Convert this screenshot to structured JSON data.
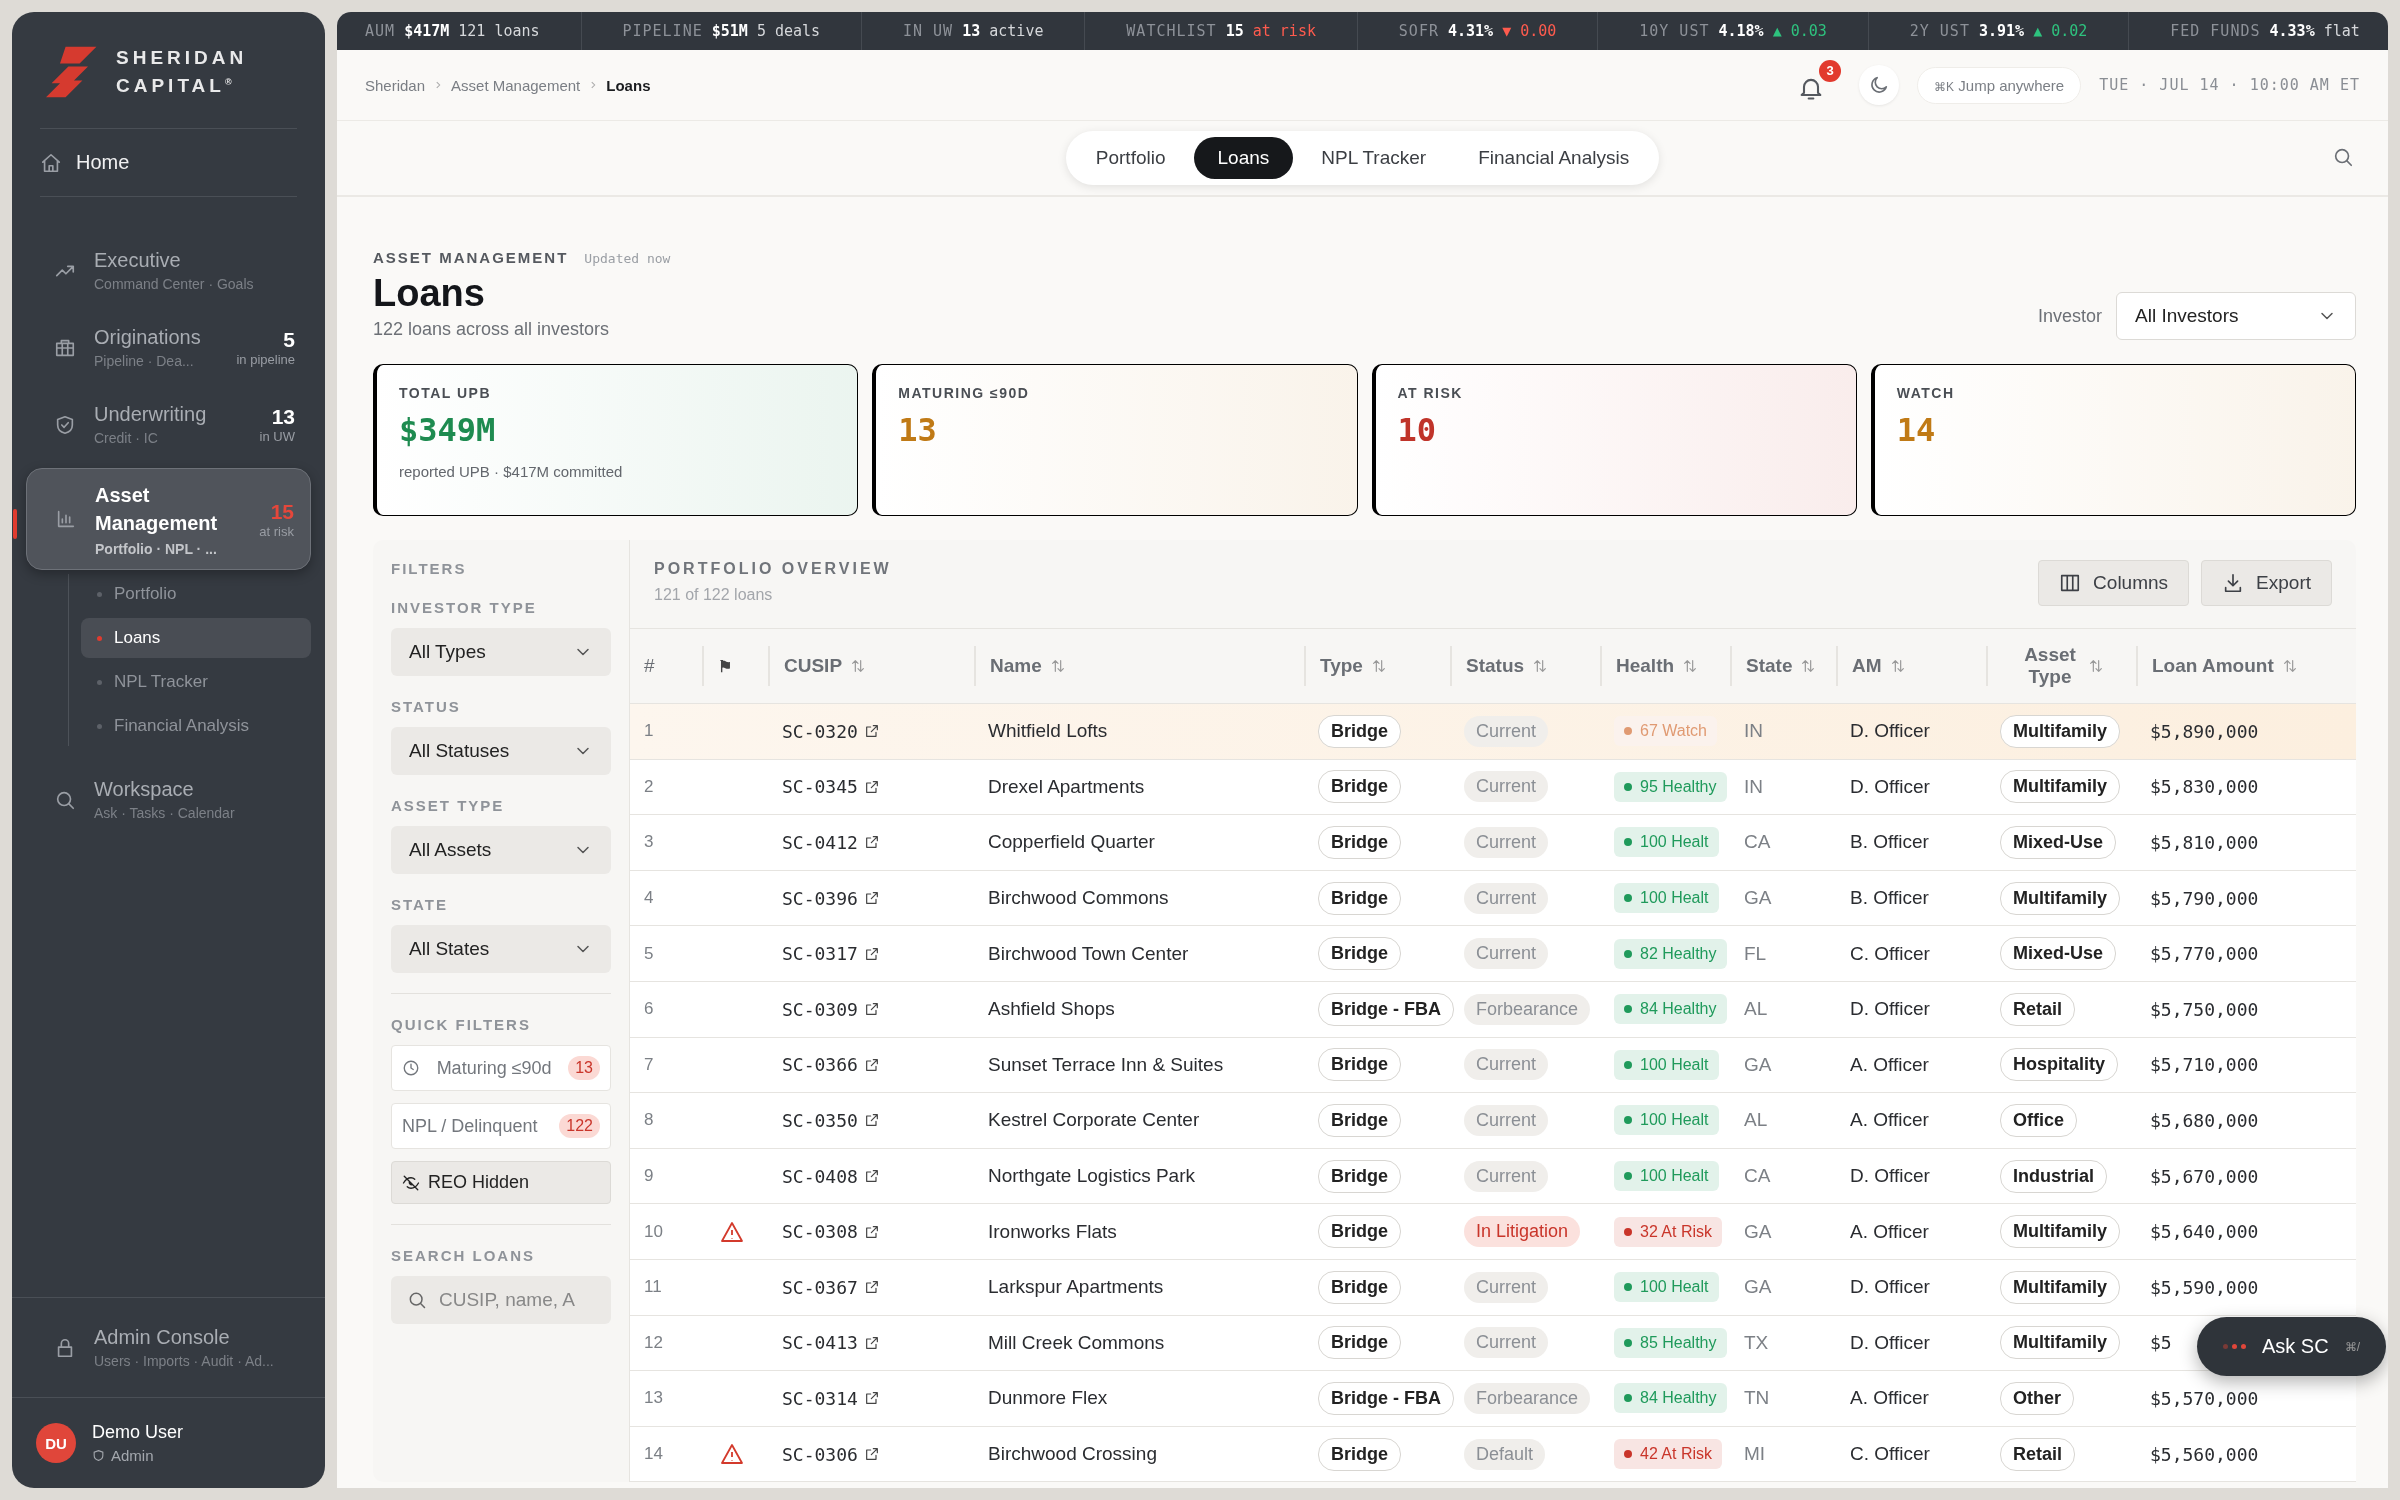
{
  "ticker": [
    {
      "label": "AUM",
      "value": "$417M",
      "note": "121 loans",
      "color": "#d6d8db"
    },
    {
      "label": "PIPELINE",
      "value": "$51M",
      "note": "5 deals",
      "color": "#d6d8db"
    },
    {
      "label": "IN UW",
      "value": "13",
      "note": "active",
      "color": "#d6d8db"
    },
    {
      "label": "WATCHLIST",
      "value": "15",
      "note": "at risk",
      "color": "#ff5b4e"
    },
    {
      "label": "SOFR",
      "value": "4.31%",
      "note": "▼ 0.00",
      "color": "#ff5b4e"
    },
    {
      "label": "10Y UST",
      "value": "4.18%",
      "note": "▲ 0.03",
      "color": "#2ec27e"
    },
    {
      "label": "2Y UST",
      "value": "3.91%",
      "note": "▲ 0.02",
      "color": "#2ec27e"
    },
    {
      "label": "FED FUNDS",
      "value": "4.33%",
      "note": "flat",
      "color": "#d6d8db"
    }
  ],
  "sidebar": {
    "logo": [
      "SHERIDAN",
      "CAPITAL"
    ],
    "logo_mark": "®",
    "home": {
      "label": "Home"
    },
    "items": [
      {
        "kind": "trend",
        "label": "Executive",
        "sub": "Command Center · Goals",
        "selected": false
      },
      {
        "kind": "briefcase",
        "label": "Originations",
        "sub": "Pipeline · Dea...",
        "count": "5",
        "count_note": "in pipeline",
        "color": "#ffffff",
        "selected": false
      },
      {
        "kind": "shield",
        "label": "Underwriting",
        "sub": "Credit · IC",
        "count": "13",
        "count_note": "in UW",
        "color": "#ffffff",
        "selected": false
      },
      {
        "kind": "chart",
        "label": "Asset Management",
        "sub": "Portfolio · NPL · ...",
        "count": "15",
        "count_note": "at risk",
        "color": "#e5473b",
        "selected": true,
        "children": [
          {
            "label": "Portfolio",
            "selected": false
          },
          {
            "label": "Loans",
            "selected": true
          },
          {
            "label": "NPL Tracker",
            "selected": false
          },
          {
            "label": "Financial Analysis",
            "selected": false
          }
        ]
      },
      {
        "kind": "search",
        "label": "Workspace",
        "sub": "Ask · Tasks · Calendar",
        "selected": false
      }
    ],
    "admin": {
      "label": "Admin Console",
      "sub": "Users · Imports · Audit · Ad..."
    },
    "user": {
      "initials": "DU",
      "name": "Demo User",
      "role": "Admin"
    }
  },
  "header": {
    "breadcrumbs": [
      "Sheridan",
      "Asset Management",
      "Loans"
    ],
    "notifications": "3",
    "jump": {
      "shortcut": "⌘K",
      "label": "Jump anywhere"
    },
    "datetime": "TUE · JUL 14 · 10:00 AM ET"
  },
  "tabs": [
    {
      "label": "Portfolio",
      "selected": false
    },
    {
      "label": "Loans",
      "selected": true
    },
    {
      "label": "NPL Tracker",
      "selected": false
    },
    {
      "label": "Financial Analysis",
      "selected": false
    }
  ],
  "page": {
    "eyebrow": "ASSET MANAGEMENT",
    "updated": "Updated now",
    "title": "Loans",
    "subtitle": "122 loans across all investors",
    "investor_label": "Investor",
    "investor_value": "All Investors"
  },
  "cards": [
    {
      "label": "TOTAL UPB",
      "value": "$349M",
      "note": "reported UPB · $417M committed",
      "color": "#1e8b50"
    },
    {
      "label": "MATURING ≤90D",
      "value": "13",
      "color": "#c07a16"
    },
    {
      "label": "AT RISK",
      "value": "10",
      "color": "#c0342a"
    },
    {
      "label": "WATCH",
      "value": "14",
      "color": "#c07a16"
    }
  ],
  "filters": {
    "title": "FILTERS",
    "selects": [
      {
        "label": "INVESTOR TYPE",
        "value": "All Types"
      },
      {
        "label": "STATUS",
        "value": "All Statuses"
      },
      {
        "label": "ASSET TYPE",
        "value": "All Assets"
      },
      {
        "label": "STATE",
        "value": "All States"
      }
    ],
    "quick_title": "QUICK FILTERS",
    "quick": [
      {
        "kind": "clock",
        "label": "Maturing ≤90d",
        "count": "13",
        "on": false
      },
      {
        "kind": "plain",
        "label": "NPL / Delinquent",
        "count": "122",
        "on": false
      },
      {
        "kind": "eye-off",
        "label": "REO Hidden",
        "on": true
      }
    ],
    "search_title": "SEARCH LOANS",
    "search_placeholder": "CUSIP, name, A"
  },
  "table": {
    "title": "PORTFOLIO OVERVIEW",
    "subtitle": "121 of 122 loans",
    "buttons": [
      {
        "kind": "columns",
        "label": "Columns"
      },
      {
        "kind": "download",
        "label": "Export"
      }
    ],
    "columns": [
      "#",
      "⚑",
      "CUSIP",
      "Name",
      "Type",
      "Status",
      "Health",
      "State",
      "AM",
      "Asset Type",
      "Loan Amount"
    ],
    "rows": [
      {
        "n": "1",
        "flagged": false,
        "selected": true,
        "cusip": "SC-0320",
        "name": "Whitfield Lofts",
        "type": "Bridge",
        "status": {
          "label": "Current",
          "color": "#8b8f95"
        },
        "health": {
          "label": "67 Watch",
          "color": "#e09a72"
        },
        "state": "IN",
        "am": "D. Officer",
        "asset": "Multifamily",
        "amount": "$5,890,000"
      },
      {
        "n": "2",
        "flagged": false,
        "selected": false,
        "cusip": "SC-0345",
        "name": "Drexel Apartments",
        "type": "Bridge",
        "status": {
          "label": "Current",
          "color": "#8b8f95"
        },
        "health": {
          "label": "95 Healthy",
          "color": "#1f9a5b"
        },
        "state": "IN",
        "am": "D. Officer",
        "asset": "Multifamily",
        "amount": "$5,830,000"
      },
      {
        "n": "3",
        "flagged": false,
        "selected": false,
        "cusip": "SC-0412",
        "name": "Copperfield Quarter",
        "type": "Bridge",
        "status": {
          "label": "Current",
          "color": "#8b8f95"
        },
        "health": {
          "label": "100 Healt",
          "color": "#1f9a5b"
        },
        "state": "CA",
        "am": "B. Officer",
        "asset": "Mixed-Use",
        "amount": "$5,810,000"
      },
      {
        "n": "4",
        "flagged": false,
        "selected": false,
        "cusip": "SC-0396",
        "name": "Birchwood Commons",
        "type": "Bridge",
        "status": {
          "label": "Current",
          "color": "#8b8f95"
        },
        "health": {
          "label": "100 Healt",
          "color": "#1f9a5b"
        },
        "state": "GA",
        "am": "B. Officer",
        "asset": "Multifamily",
        "amount": "$5,790,000"
      },
      {
        "n": "5",
        "flagged": false,
        "selected": false,
        "cusip": "SC-0317",
        "name": "Birchwood Town Center",
        "type": "Bridge",
        "status": {
          "label": "Current",
          "color": "#8b8f95"
        },
        "health": {
          "label": "82 Healthy",
          "color": "#1f9a5b"
        },
        "state": "FL",
        "am": "C. Officer",
        "asset": "Mixed-Use",
        "amount": "$5,770,000"
      },
      {
        "n": "6",
        "flagged": false,
        "selected": false,
        "cusip": "SC-0309",
        "name": "Ashfield Shops",
        "type": "Bridge - FBA",
        "status": {
          "label": "Forbearance",
          "color": "#8b8f95"
        },
        "health": {
          "label": "84 Healthy",
          "color": "#1f9a5b"
        },
        "state": "AL",
        "am": "D. Officer",
        "asset": "Retail",
        "amount": "$5,750,000"
      },
      {
        "n": "7",
        "flagged": false,
        "selected": false,
        "cusip": "SC-0366",
        "name": "Sunset Terrace Inn & Suites",
        "type": "Bridge",
        "status": {
          "label": "Current",
          "color": "#8b8f95"
        },
        "health": {
          "label": "100 Healt",
          "color": "#1f9a5b"
        },
        "state": "GA",
        "am": "A. Officer",
        "asset": "Hospitality",
        "amount": "$5,710,000"
      },
      {
        "n": "8",
        "flagged": false,
        "selected": false,
        "cusip": "SC-0350",
        "name": "Kestrel Corporate Center",
        "type": "Bridge",
        "status": {
          "label": "Current",
          "color": "#8b8f95"
        },
        "health": {
          "label": "100 Healt",
          "color": "#1f9a5b"
        },
        "state": "AL",
        "am": "A. Officer",
        "asset": "Office",
        "amount": "$5,680,000"
      },
      {
        "n": "9",
        "flagged": false,
        "selected": false,
        "cusip": "SC-0408",
        "name": "Northgate Logistics Park",
        "type": "Bridge",
        "status": {
          "label": "Current",
          "color": "#8b8f95"
        },
        "health": {
          "label": "100 Healt",
          "color": "#1f9a5b"
        },
        "state": "CA",
        "am": "D. Officer",
        "asset": "Industrial",
        "amount": "$5,670,000"
      },
      {
        "n": "10",
        "flagged": true,
        "selected": false,
        "cusip": "SC-0308",
        "name": "Ironworks Flats",
        "type": "Bridge",
        "status": {
          "label": "In Litigation",
          "color": "#c9352a"
        },
        "health": {
          "label": "32 At Risk",
          "color": "#c9352a"
        },
        "state": "GA",
        "am": "A. Officer",
        "asset": "Multifamily",
        "amount": "$5,640,000"
      },
      {
        "n": "11",
        "flagged": false,
        "selected": false,
        "cusip": "SC-0367",
        "name": "Larkspur Apartments",
        "type": "Bridge",
        "status": {
          "label": "Current",
          "color": "#8b8f95"
        },
        "health": {
          "label": "100 Healt",
          "color": "#1f9a5b"
        },
        "state": "GA",
        "am": "D. Officer",
        "asset": "Multifamily",
        "amount": "$5,590,000"
      },
      {
        "n": "12",
        "flagged": false,
        "selected": false,
        "cusip": "SC-0413",
        "name": "Mill Creek Commons",
        "type": "Bridge",
        "status": {
          "label": "Current",
          "color": "#8b8f95"
        },
        "health": {
          "label": "85 Healthy",
          "color": "#1f9a5b"
        },
        "state": "TX",
        "am": "D. Officer",
        "asset": "Multifamily",
        "amount": "$5"
      },
      {
        "n": "13",
        "flagged": false,
        "selected": false,
        "cusip": "SC-0314",
        "name": "Dunmore Flex",
        "type": "Bridge - FBA",
        "status": {
          "label": "Forbearance",
          "color": "#8b8f95"
        },
        "health": {
          "label": "84 Healthy",
          "color": "#1f9a5b"
        },
        "state": "TN",
        "am": "A. Officer",
        "asset": "Other",
        "amount": "$5,570,000"
      },
      {
        "n": "14",
        "flagged": true,
        "selected": false,
        "cusip": "SC-0306",
        "name": "Birchwood Crossing",
        "type": "Bridge",
        "status": {
          "label": "Default",
          "color": "#8b8f95"
        },
        "health": {
          "label": "42 At Risk",
          "color": "#c9352a"
        },
        "state": "MI",
        "am": "C. Officer",
        "asset": "Retail",
        "amount": "$5,560,000"
      }
    ]
  },
  "assistant": {
    "label": "Ask SC",
    "shortcut": "⌘/"
  }
}
